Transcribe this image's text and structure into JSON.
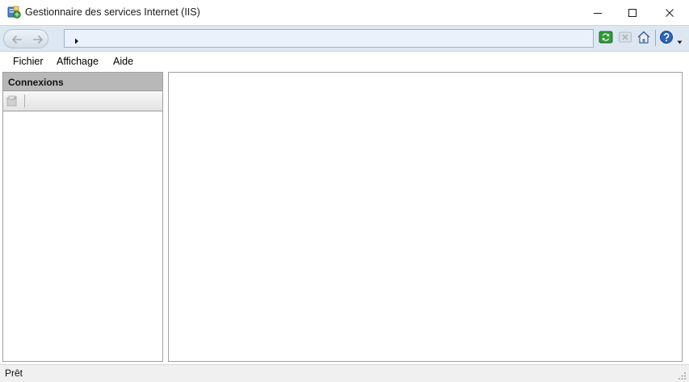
{
  "window": {
    "title": "Gestionnaire des services Internet (IIS)",
    "app_icon": "iis-manager-icon",
    "controls": [
      "minimize-icon",
      "maximize-icon",
      "close-icon"
    ]
  },
  "navigation": {
    "back_icon": "arrow-left-icon",
    "forward_icon": "arrow-right-icon",
    "address_path": "",
    "address_icon": "breadcrumb-arrow-icon",
    "tools": [
      "refresh-icon",
      "stop-icon",
      "home-icon",
      "help-icon"
    ]
  },
  "menu": {
    "items": [
      {
        "label": "Fichier"
      },
      {
        "label": "Affichage"
      },
      {
        "label": "Aide"
      }
    ]
  },
  "connections": {
    "title": "Connexions",
    "toolbar_icon": "connect-icon"
  },
  "status": {
    "text": "Prêt"
  },
  "colors": {
    "navbar": "#dde7f2",
    "address_bg": "#eaf1fb",
    "pane_header": "#b8b8b8",
    "statusbar": "#f0f0f0"
  }
}
